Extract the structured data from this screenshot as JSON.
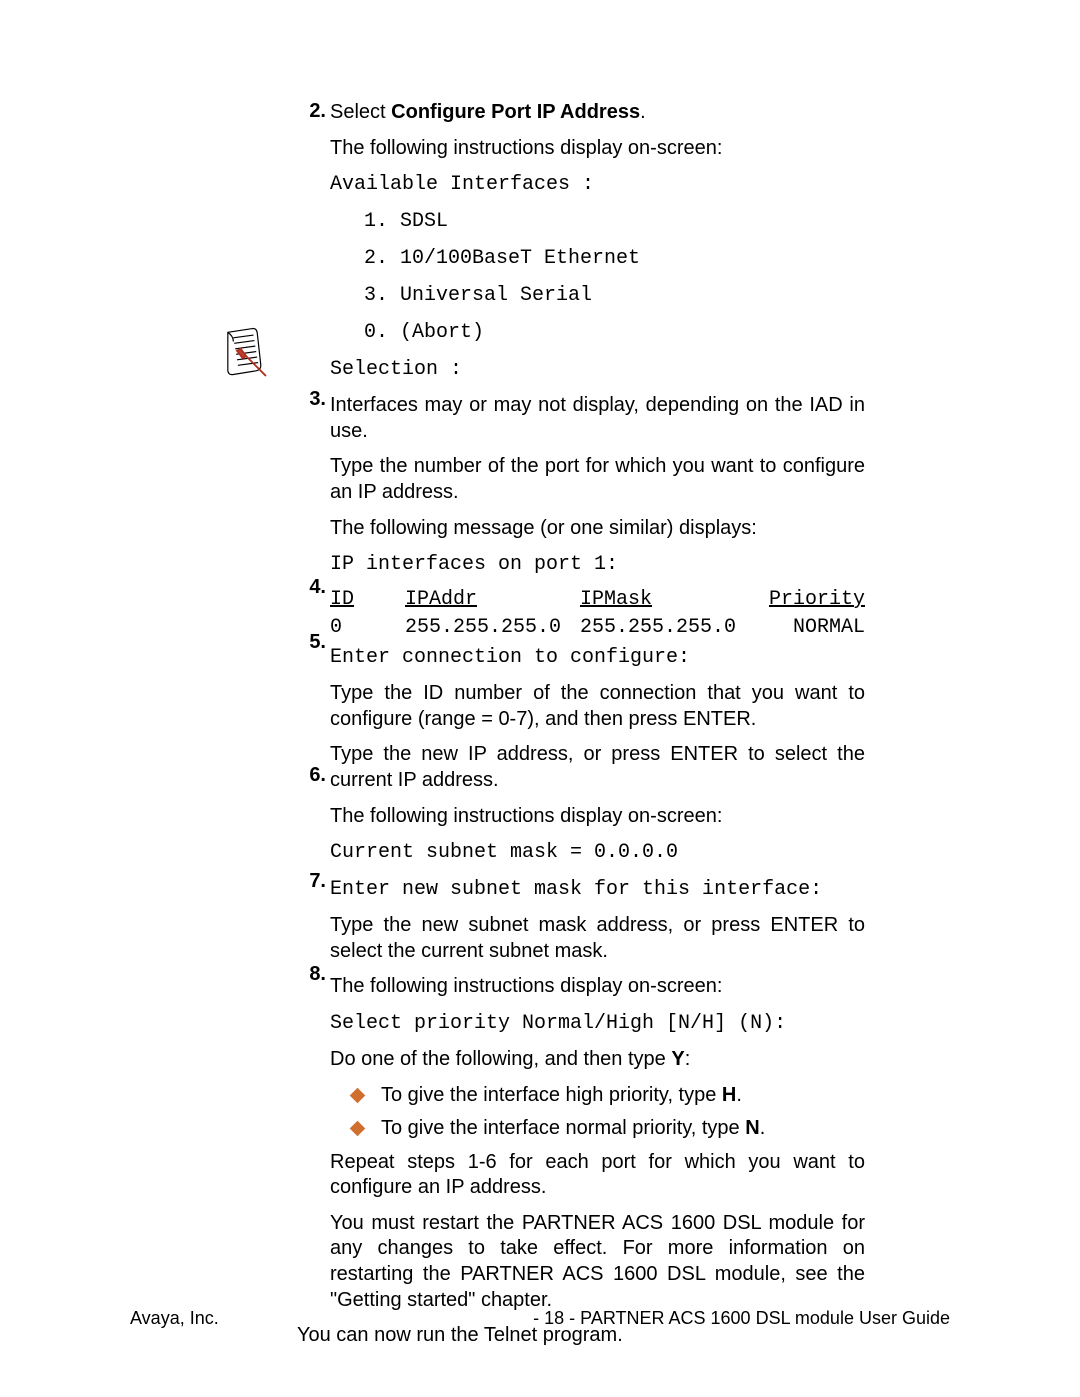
{
  "footer": {
    "left": "Avaya, Inc.",
    "right_prefix": "- 18 -  ",
    "right_title": "PARTNER ACS 1600 DSL module User Guide"
  },
  "step2": {
    "num": "2.",
    "line1_a": "Select ",
    "line1_b": "Configure Port IP Address",
    "line1_c": ".",
    "line2": "The following instructions display on-screen:",
    "mono_header": "Available Interfaces :",
    "opt1": "1. SDSL",
    "opt2": "2. 10/100BaseT Ethernet",
    "opt3": "3. Universal Serial",
    "opt4": "0. (Abort)",
    "selection": "Selection :",
    "note": "Interfaces may or may not display, depending on the IAD in use."
  },
  "step3": {
    "num": "3.",
    "line1": "Type the number of the port for which you want to configure an IP address.",
    "line2": "The following message (or one similar) displays:",
    "mono1": "IP interfaces on port 1:",
    "th_id": "ID",
    "th_ipaddr": "IPAddr",
    "th_ipmask": "IPMask",
    "th_priority": "Priority",
    "row_id": "0",
    "row_ipaddr": "255.255.255.0",
    "row_ipmask": "255.255.255.0",
    "row_priority": "NORMAL",
    "mono2": "Enter connection to configure:"
  },
  "step4": {
    "num": "4.",
    "text": "Type the ID number of the connection that you want to configure (range = 0-7), and then press ENTER."
  },
  "step5": {
    "num": "5.",
    "line1": "Type the new IP address, or press ENTER to select the current IP address.",
    "line2": "The following instructions display on-screen:",
    "mono1": "Current subnet mask = 0.0.0.0",
    "mono2": "Enter new subnet mask for this interface:"
  },
  "step6": {
    "num": "6.",
    "line1": "Type the new subnet mask address, or press ENTER to select the current subnet mask.",
    "line2": "The following instructions display on-screen:",
    "mono1": "Select priority Normal/High [N/H] (N):"
  },
  "step7": {
    "num": "7.",
    "line1_a": "Do one of the following, and then type ",
    "line1_b": "Y",
    "line1_c": ":",
    "bullet1_a": "To give the interface high priority, type ",
    "bullet1_b": "H",
    "bullet1_c": ".",
    "bullet2_a": "To give the interface normal priority, type ",
    "bullet2_b": "N",
    "bullet2_c": "."
  },
  "step8": {
    "num": "8.",
    "line1": "Repeat steps 1-6 for each port for which you want to configure an IP address.",
    "line2": "You must restart the PARTNER ACS 1600 DSL module for any changes to take effect.  For more information on restarting the PARTNER ACS 1600 DSL module, see the \"Getting started\" chapter."
  },
  "closing": "You can now run the Telnet program."
}
